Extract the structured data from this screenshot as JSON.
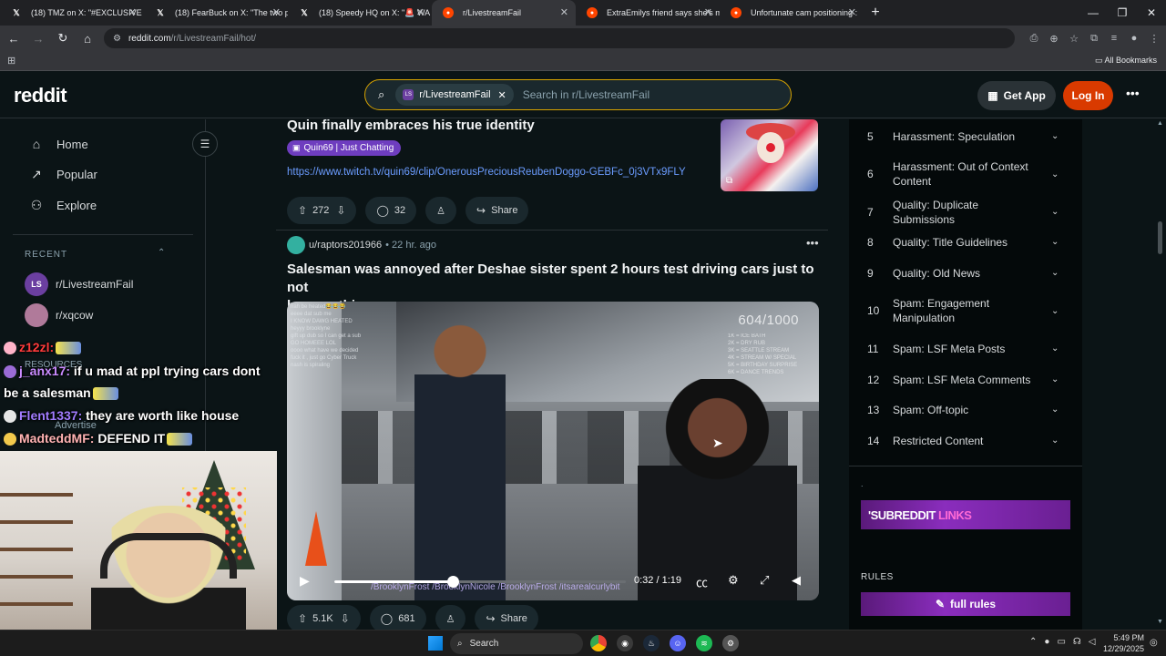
{
  "browser": {
    "tabs": [
      {
        "title": "(18) TMZ on X: \"#EXCLUSIVE 👗",
        "icon": "x-logo-icon",
        "active": false
      },
      {
        "title": "(18) FearBuck on X: \"The two p",
        "icon": "x-logo-icon",
        "active": false
      },
      {
        "title": "(18) Speedy HQ on X: \"🚨 WA",
        "icon": "x-logo-icon",
        "active": false
      },
      {
        "title": "r/LivestreamFail",
        "icon": "reddit-icon",
        "active": true
      },
      {
        "title": "ExtraEmilys friend says she's m",
        "icon": "reddit-icon",
        "active": false
      },
      {
        "title": "Unfortunate cam positioning :",
        "icon": "reddit-icon",
        "active": false
      }
    ],
    "new_tab": "+",
    "url_host": "reddit.com",
    "url_path": "/r/LivestreamFail/hot/",
    "all_bookmarks": "All Bookmarks"
  },
  "reddit": {
    "logo": "reddit",
    "search": {
      "chip_label": "r/LivestreamFail",
      "chip_avatar": "LS",
      "placeholder": "Search in r/LivestreamFail"
    },
    "get_app": "Get App",
    "login": "Log In"
  },
  "left_nav": {
    "items": [
      {
        "label": "Home",
        "icon": "home-icon",
        "glyph": "⌂"
      },
      {
        "label": "Popular",
        "icon": "popular-icon",
        "glyph": "↗"
      },
      {
        "label": "Explore",
        "icon": "explore-icon",
        "glyph": "⚇"
      }
    ],
    "recent_heading": "RECENT",
    "recent": [
      {
        "label": "r/LivestreamFail",
        "avatar": "LS",
        "color": "#6b3fa0"
      },
      {
        "label": "r/xqcow",
        "avatar": "",
        "color": "#b07a9a"
      }
    ],
    "ghost_resources": "RESOURCES",
    "ghost_advertise": "Advertise"
  },
  "posts": [
    {
      "title": "Quin finally embraces his true identity",
      "flair": "Quin69 | Just Chatting",
      "link": "https://www.twitch.tv/quin69/clip/OnerousPreciousReubenDoggo-GEBFc_0j3VTx9FLY",
      "upvotes": "272",
      "comments": "32",
      "share": "Share"
    },
    {
      "author": "u/raptors201966",
      "time": "22 hr. ago",
      "title_line1": "Salesman was annoyed after Deshae sister spent 2 hours test driving cars just to not",
      "title_line2": "buy anything.",
      "upvotes": "5.1K",
      "comments": "681",
      "share": "Share",
      "video": {
        "counter": "604/1000",
        "current_time": "0:32",
        "duration": "1:19",
        "progress": 0.405,
        "socials": "/BrooklynFrost  /BrooklynNicole  /BrooklynFrost  /itsarealcurlybit",
        "chat_lines": [
          "nah be heated😂😂😂",
          "eeee dat sub me",
          "I KNOW DAWG HEATED",
          "heyyy brooklyne",
          "gift up dub so I can get a sub",
          "GO HOMEEE LOL",
          "oooo what have we decided",
          "fuck it , just go Cyber Truck",
          "nash is spiraling"
        ],
        "list_lines": [
          "1K = ICE BATH",
          "2K = DRY RUB",
          "3K = SEATTLE STREAM",
          "4K = STREAM W/ SPECIAL",
          "5K = BIRTHDAY SURPRISE",
          "6K = DANCE TRENDS"
        ]
      }
    }
  ],
  "rules": [
    {
      "n": "5",
      "t": "Harassment: Speculation"
    },
    {
      "n": "6",
      "t": "Harassment: Out of Context Content"
    },
    {
      "n": "7",
      "t": "Quality: Duplicate Submissions"
    },
    {
      "n": "8",
      "t": "Quality: Title Guidelines"
    },
    {
      "n": "9",
      "t": "Quality: Old News"
    },
    {
      "n": "10",
      "t": "Spam: Engagement Manipulation"
    },
    {
      "n": "11",
      "t": "Spam: LSF Meta Posts"
    },
    {
      "n": "12",
      "t": "Spam: LSF Meta Comments"
    },
    {
      "n": "13",
      "t": "Spam: Off-topic"
    },
    {
      "n": "14",
      "t": "Restricted Content"
    }
  ],
  "sidebar": {
    "dot": ".",
    "banner_text": "'SUBREDDIT",
    "banner_highlight": "LINKS",
    "rules_heading": "RULES",
    "full_rules": "full rules"
  },
  "stream_chat": [
    {
      "user": "z12zl:",
      "msg": "",
      "user_color": "un"
    },
    {
      "user": "j_anx17:",
      "msg": " if u mad at ppl trying cars dont",
      "user_color": "un2"
    },
    {
      "user": "",
      "msg": "be a salesman",
      "user_color": ""
    },
    {
      "user": "Flent1337:",
      "msg": " they are worth like house",
      "user_color": "un3"
    },
    {
      "user": "MadteddMF:",
      "msg": " DEFEND IT",
      "user_color": "un4"
    }
  ],
  "taskbar": {
    "search": "Search",
    "time": "5:49 PM",
    "date": "12/29/2025"
  }
}
